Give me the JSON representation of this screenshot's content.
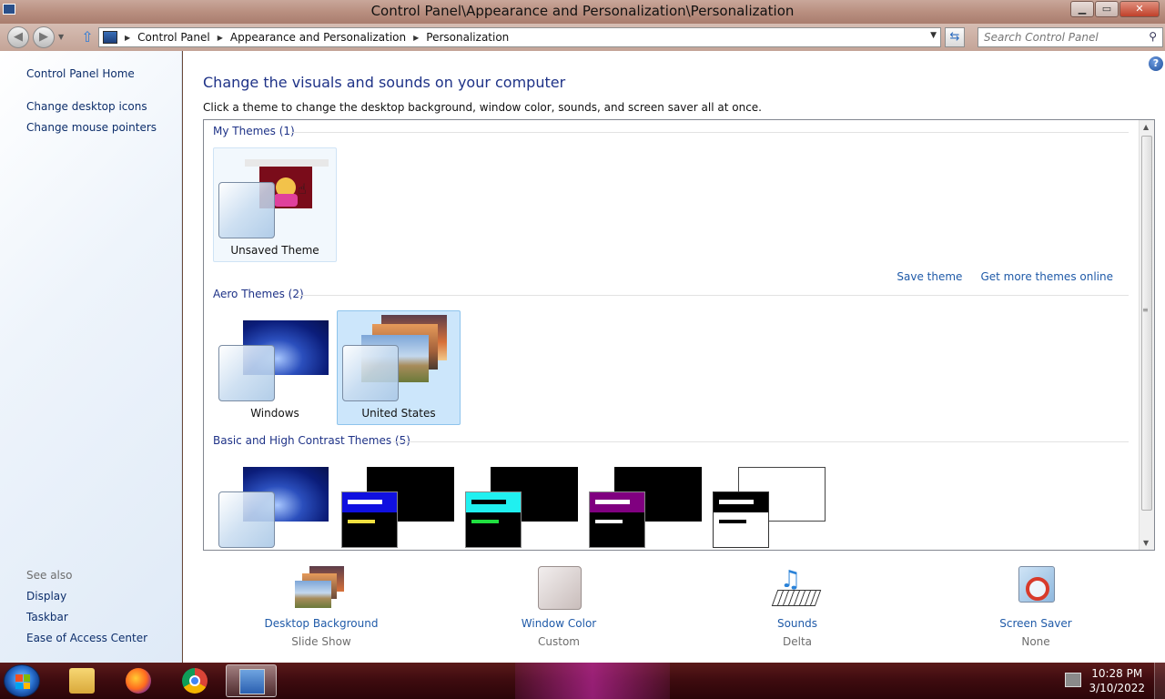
{
  "window": {
    "title": "Control Panel\\Appearance and Personalization\\Personalization",
    "minimize": "▁",
    "restore": "▭",
    "close": "✕"
  },
  "address_bar": {
    "crumbs": [
      "Control Panel",
      "Appearance and Personalization",
      "Personalization"
    ],
    "search_placeholder": "Search Control Panel"
  },
  "sidebar": {
    "home": "Control Panel Home",
    "links": [
      "Change desktop icons",
      "Change mouse pointers"
    ],
    "see_also_label": "See also",
    "see_also": [
      "Display",
      "Taskbar",
      "Ease of Access Center"
    ]
  },
  "main": {
    "heading": "Change the visuals and sounds on your computer",
    "subheading": "Click a theme to change the desktop background, window color, sounds, and screen saver all at once.",
    "groups": {
      "my_themes": {
        "title": "My Themes (1)",
        "themes": [
          {
            "label": "Unsaved Theme"
          }
        ]
      },
      "aero_themes": {
        "title": "Aero Themes (2)",
        "themes": [
          {
            "label": "Windows"
          },
          {
            "label": "United States"
          }
        ]
      },
      "basic_themes": {
        "title": "Basic and High Contrast Themes (5)"
      }
    },
    "save_theme": "Save theme",
    "get_more_themes": "Get more themes online",
    "bottom": [
      {
        "title": "Desktop Background",
        "sub": "Slide Show"
      },
      {
        "title": "Window Color",
        "sub": "Custom"
      },
      {
        "title": "Sounds",
        "sub": "Delta"
      },
      {
        "title": "Screen Saver",
        "sub": "None"
      }
    ]
  },
  "taskbar": {
    "time": "10:28 PM",
    "date": "3/10/2022"
  },
  "colors": {
    "link": "#1f5aa8",
    "heading": "#1e3287",
    "selected_bg": "#cce6fb"
  }
}
